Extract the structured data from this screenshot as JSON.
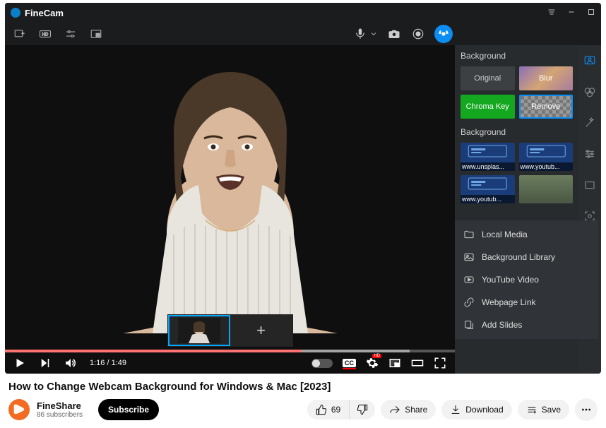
{
  "app": {
    "title": "FineCam"
  },
  "sidepanel": {
    "header1": "Background",
    "tiles": {
      "original": "Original",
      "blur": "Blur",
      "chroma": "Chroma Key",
      "remove": "Remove"
    },
    "header2": "Background",
    "thumbs": [
      "www.unsplas...",
      "www.youtub...",
      "www.youtub..."
    ]
  },
  "menu": {
    "local": "Local Media",
    "library": "Background Library",
    "youtube": "YouTube Video",
    "webpage": "Webpage Link",
    "slides": "Add Slides"
  },
  "player": {
    "time": "1:16 / 1:49",
    "progress_pct": 66,
    "buffer_pct": 90,
    "cc": "CC",
    "settings_badge": "HD"
  },
  "video": {
    "title": "How to Change Webcam Background for Windows & Mac [2023]",
    "channel": "FineShare",
    "subscribers": "86 subscribers",
    "subscribe": "Subscribe",
    "likes": "69",
    "share": "Share",
    "download": "Download",
    "save": "Save"
  }
}
